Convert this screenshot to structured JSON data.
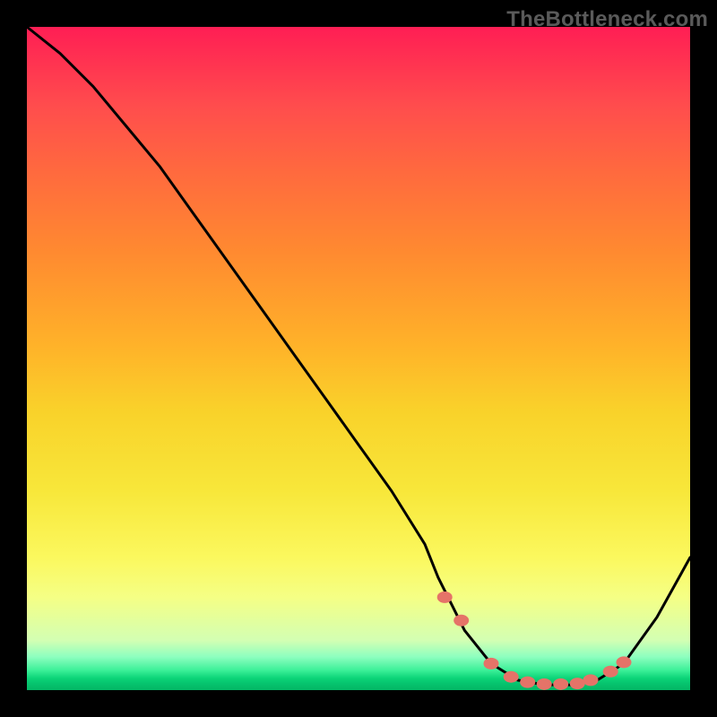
{
  "watermark": "TheBottleneck.com",
  "chart_data": {
    "type": "line",
    "title": "",
    "xlabel": "",
    "ylabel": "",
    "xlim": [
      0,
      100
    ],
    "ylim": [
      0,
      100
    ],
    "series": [
      {
        "name": "bottleneck-curve",
        "x": [
          0,
          5,
          10,
          15,
          20,
          25,
          30,
          35,
          40,
          45,
          50,
          55,
          60,
          62,
          66,
          70,
          74,
          78,
          82,
          86,
          90,
          95,
          100
        ],
        "y": [
          100,
          96,
          91,
          85,
          79,
          72,
          65,
          58,
          51,
          44,
          37,
          30,
          22,
          17,
          9,
          4,
          1.5,
          0.8,
          0.8,
          1.5,
          4,
          11,
          20
        ]
      }
    ],
    "markers": {
      "name": "highlight-dots",
      "x": [
        63,
        65.5,
        70,
        73,
        75.5,
        78,
        80.5,
        83,
        85,
        88,
        90
      ],
      "y": [
        14,
        10.5,
        4,
        2,
        1.2,
        0.9,
        0.9,
        1,
        1.5,
        2.8,
        4.2
      ]
    }
  },
  "colors": {
    "curve": "#000000",
    "dots": "#e57368",
    "top_gradient": "#ff1e54",
    "bottom_gradient": "#04b665"
  }
}
